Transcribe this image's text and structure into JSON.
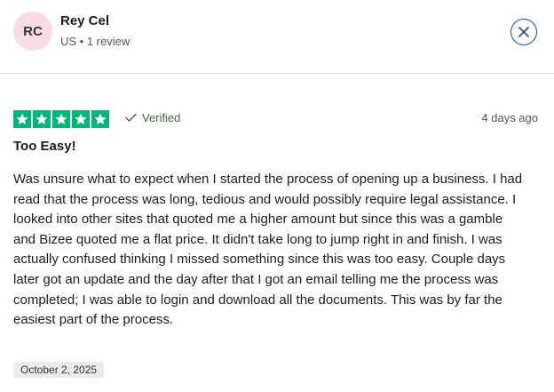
{
  "reviewer": {
    "initials": "RC",
    "name": "Rey Cel",
    "meta": "US • 1 review"
  },
  "header": {
    "close_icon": "close-icon"
  },
  "review": {
    "rating": 5,
    "max_rating": 5,
    "verified_label": "Verified",
    "posted_ago": "4 days ago",
    "title": "Too Easy!",
    "body": "Was unsure what to expect when I started the process of opening up a business. I had read that the process was long, tedious and would possibly require legal assistance. I looked into other sites that quoted me a higher amount but since this was a gamble and Bizee quoted me a flat price. It didn't take long to jump right in and finish. I was actually confused thinking I missed something since this was too easy. Couple days later got an update and the day after that I got an email telling me the process was completed; I was able to login and download all the documents. This was by far the easiest part of the process.",
    "date": "October 2, 2025"
  },
  "colors": {
    "star_green": "#00b67a",
    "avatar_bg": "#f9dbe4",
    "close_blue": "#1f4b99",
    "verified_green": "#3d6b3d"
  }
}
